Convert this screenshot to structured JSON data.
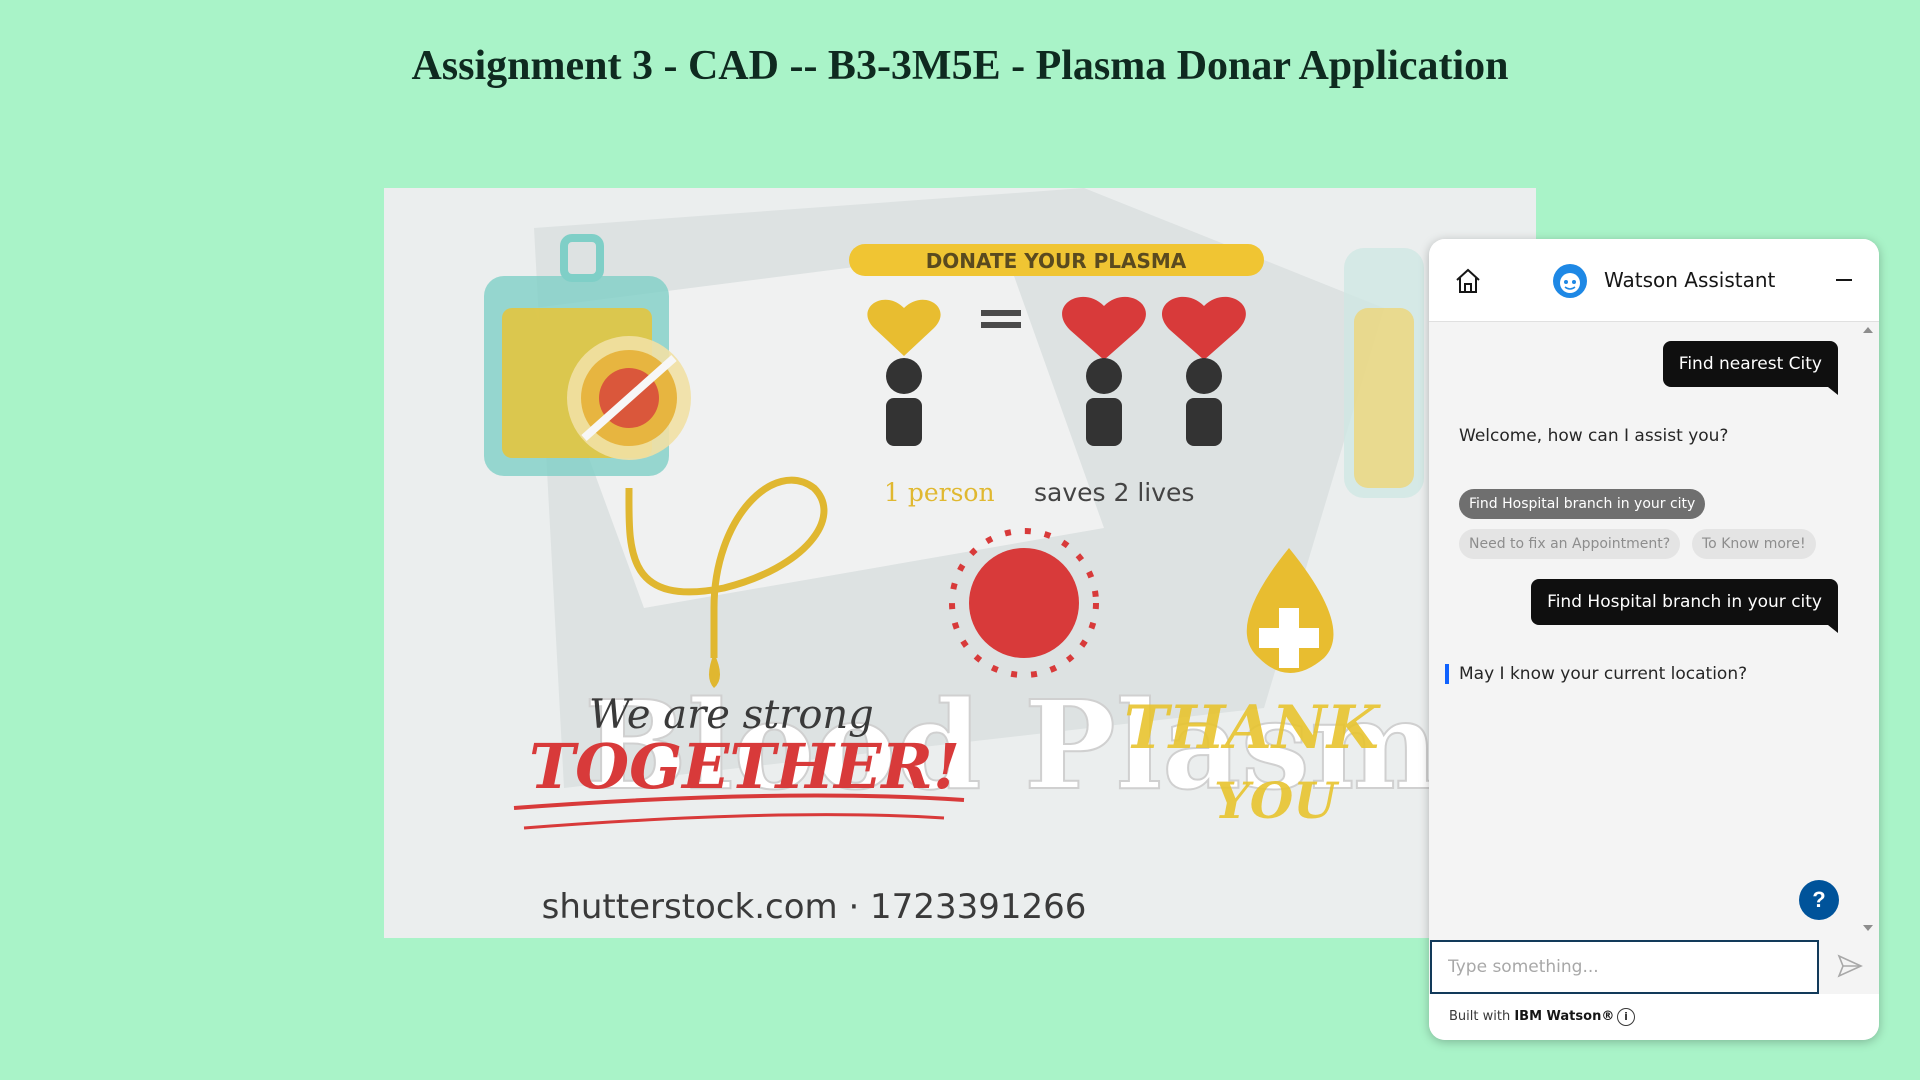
{
  "page": {
    "title": "Assignment 3 - CAD -- B3-3M5E - Plasma Donar Application"
  },
  "banner": {
    "headline": "DONATE YOUR PLASMA",
    "tagline_highlight": "1 person",
    "tagline_rest": " saves 2 lives",
    "big_text": "Blood Plasma",
    "script_text": "We are strong",
    "together_text": "TOGETHER!",
    "thank_text": "THANK",
    "you_text": "YOU",
    "watermark": "shutterstock.com · 1723391266"
  },
  "chat": {
    "header_title": "Watson Assistant",
    "messages": {
      "user1": "Find nearest City",
      "bot1": "Welcome, how can I assist you?",
      "user2": "Find Hospital branch in your city",
      "bot2": "May I know your current location?"
    },
    "chips": [
      "Find Hospital branch in your city",
      "Need to fix an Appointment?",
      "To Know more!"
    ],
    "help_label": "?",
    "input_placeholder": "Type something...",
    "footer_prefix": "Built with ",
    "footer_brand": "IBM Watson®",
    "info_label": "i"
  },
  "colors": {
    "page_background": "#a9f3c8",
    "user_bubble": "#0f0f0f",
    "help_button": "#00539a"
  }
}
